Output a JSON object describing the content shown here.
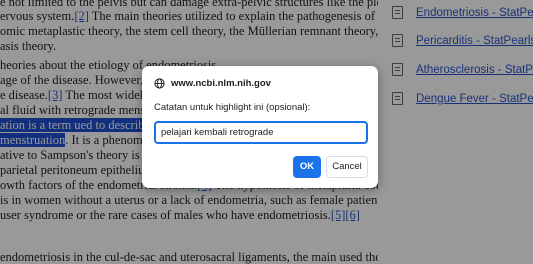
{
  "article": {
    "lines": [
      {
        "text": "",
        "segs": [
          {
            "t": "e not limited to the pelvis but can damage extra-pelvic structures like the pleura, the"
          }
        ]
      },
      {
        "segs": [
          {
            "t": "ervous system."
          },
          {
            "t": "[2]",
            "link": true
          },
          {
            "t": " The main theories utilized to explain the pathogenesis of endometriosis"
          }
        ]
      },
      {
        "segs": [
          {
            "t": "omic metaplastic theory, the stem cell theory, the Müllerian remnant theory, and the"
          }
        ]
      },
      {
        "segs": [
          {
            "t": "asis theory."
          }
        ]
      },
      {
        "segs": [
          {
            "t": "heories about the etiology of endometriosis"
          }
        ]
      },
      {
        "segs": [
          {
            "t": "age of the disease. However, none"
          }
        ]
      },
      {
        "segs": [
          {
            "t": "e disease."
          },
          {
            "t": "[3]",
            "link": true
          },
          {
            "t": " The most widely pla"
          }
        ]
      },
      {
        "segs": [
          {
            "t": "al fluid with retrograde menstruat"
          }
        ]
      },
      {
        "segs": [
          {
            "t": "ation is a term u",
            "hl": true
          },
          {
            "t": "ed to describe th",
            "hl": true
          }
        ]
      },
      {
        "segs": [
          {
            "t": " menstruation",
            "hl": true
          },
          {
            "t": ". It is a phenomenon"
          }
        ]
      },
      {
        "segs": [
          {
            "t": "ative to Sampson's theory is the c"
          }
        ]
      },
      {
        "segs": [
          {
            "t": "parietal peritoneum epithelium to differentiate into endometrial tissue, probably under"
          }
        ]
      },
      {
        "segs": [
          {
            "t": "owth factors of the endometrial stroma."
          },
          {
            "t": "[4]",
            "link": true
          },
          {
            "t": " The hypothesis of metaplasia could justify"
          }
        ]
      },
      {
        "segs": [
          {
            "t": "is in women without a uterus or a lack of endometria, such as female patients with"
          }
        ]
      },
      {
        "segs": [
          {
            "t": "user syndrome or the rare cases of males who have endometriosis."
          },
          {
            "t": "[5]",
            "link": true
          },
          {
            "t": "[6]",
            "link": true
          }
        ]
      },
      {
        "segs": [
          {
            "t": ""
          }
        ]
      },
      {
        "segs": [
          {
            "t": "endometriosis in the cul-de-sac and uterosacral ligaments, the main used theory is the"
          }
        ]
      }
    ]
  },
  "sidebar": {
    "items": [
      {
        "label": "Endometriosis - StatPearls",
        "icon": "document-icon"
      },
      {
        "label": "Pericarditis - StatPearls",
        "icon": "document-icon"
      },
      {
        "label": "Atherosclerosis - StatPearls",
        "icon": "document-icon"
      },
      {
        "label": "Dengue Fever - StatPearls",
        "icon": "document-icon"
      }
    ]
  },
  "dialog": {
    "origin": "www.ncbi.nlm.nih.gov",
    "message": "Catatan untuk highlight ini (opsional):",
    "input_value": "pelajari kembali retrograde",
    "ok_label": "OK",
    "cancel_label": "Cancel"
  },
  "colors": {
    "accent": "#1a73e8",
    "link": "#2a55c9",
    "highlight": "#1f4fd0"
  }
}
